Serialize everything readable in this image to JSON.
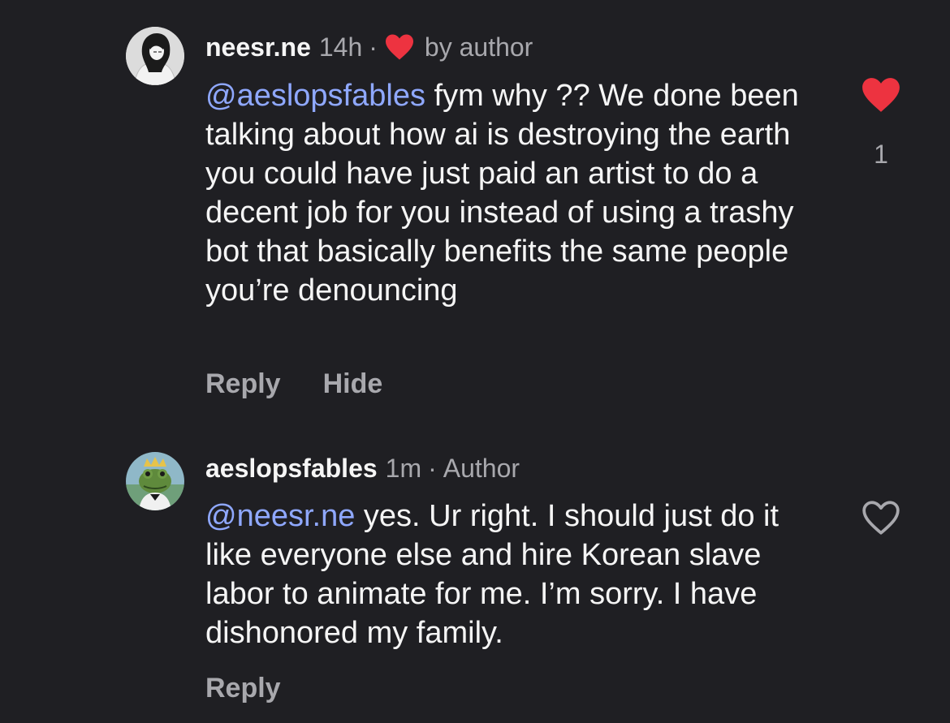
{
  "comments": [
    {
      "username": "neesr.ne",
      "time": "14h",
      "dot": "·",
      "badge": "by author",
      "mention": "@aeslopsfables",
      "text": " fym why ?? We done been talking about how ai  is destroying the earth you could have just paid an artist to do a decent job for you instead of using a trashy bot that basically benefits the same people you’re denouncing",
      "actions": {
        "reply": "Reply",
        "hide": "Hide"
      },
      "liked": true,
      "like_count": "1"
    },
    {
      "username": "aeslopsfables",
      "time": "1m",
      "dot": "·",
      "badge": "Author",
      "mention": "@neesr.ne",
      "text": " yes. Ur right. I should just do it like everyone else and hire Korean slave labor to animate for me. I’m sorry. I have dishonored my family.",
      "actions": {
        "reply": "Reply"
      },
      "liked": false
    }
  ],
  "colors": {
    "background": "#1f1f23",
    "mention": "#8fa8ff",
    "muted": "#a8a8ad",
    "heart": "#ed3340"
  },
  "icons": {
    "author_heart": "heart-filled-icon",
    "like_active": "heart-filled-icon",
    "like_inactive": "heart-outline-icon"
  }
}
